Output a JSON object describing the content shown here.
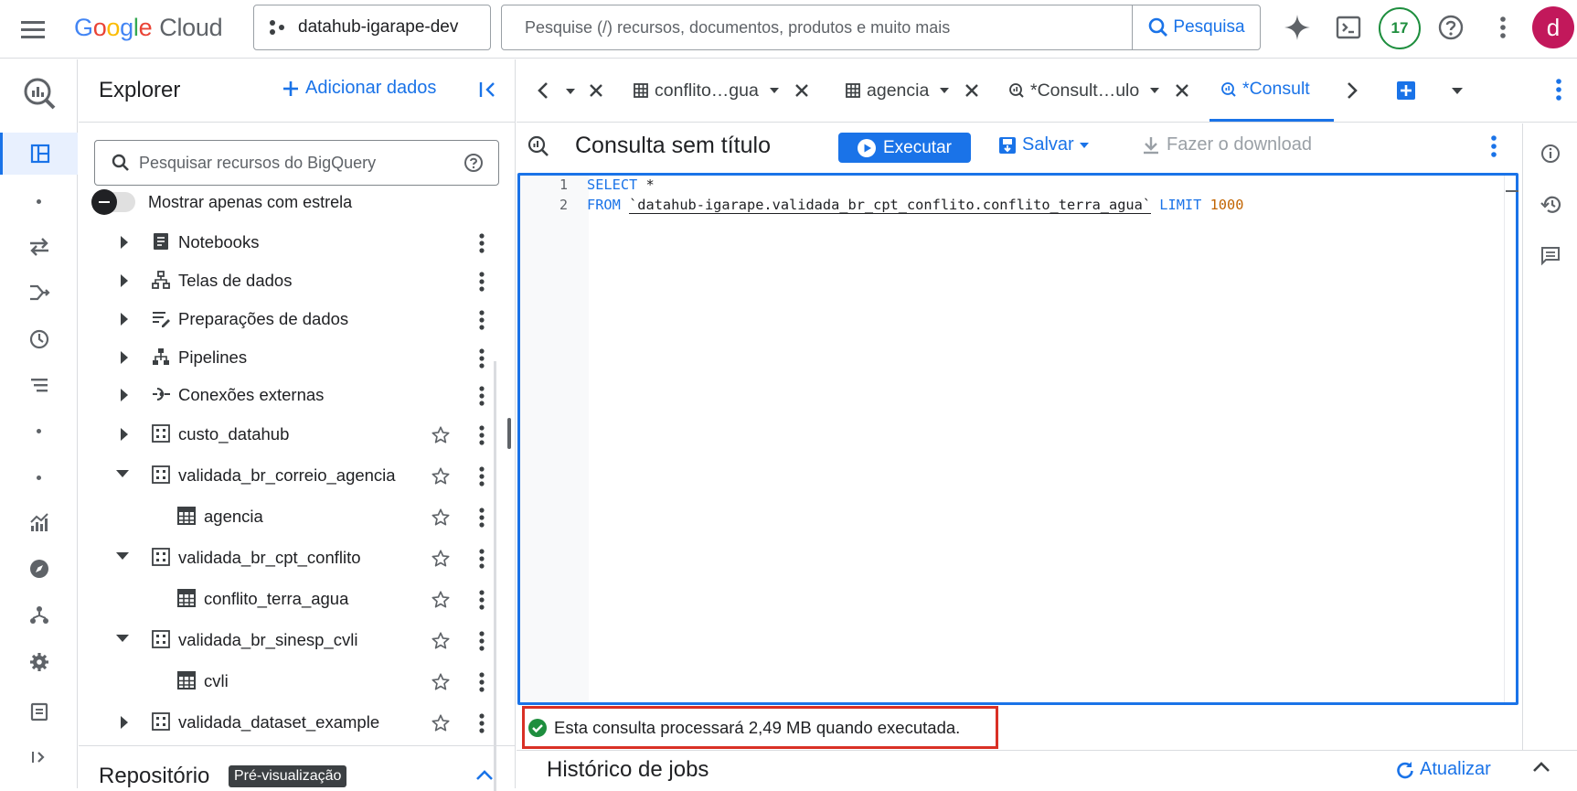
{
  "header": {
    "logo_google": [
      "G",
      "o",
      "o",
      "g",
      "l",
      "e"
    ],
    "logo_cloud": "Cloud",
    "project": "datahub-igarape-dev",
    "search_placeholder": "Pesquise (/) recursos, documentos, produtos e muito mais",
    "search_button": "Pesquisa",
    "notifications_count": "17",
    "avatar_letter": "d"
  },
  "explorer": {
    "title": "Explorer",
    "add_data": "Adicionar dados",
    "search_placeholder": "Pesquisar recursos do BigQuery",
    "star_toggle_label": "Mostrar apenas com estrela",
    "items": [
      {
        "label": "Notebooks",
        "icon": "notebook-icon",
        "expanded": false
      },
      {
        "label": "Telas de dados",
        "icon": "canvas-icon",
        "expanded": false
      },
      {
        "label": "Preparações de dados",
        "icon": "data-prep-icon",
        "expanded": false
      },
      {
        "label": "Pipelines",
        "icon": "pipeline-icon",
        "expanded": false
      },
      {
        "label": "Conexões externas",
        "icon": "connection-icon",
        "expanded": false
      },
      {
        "label": "custo_datahub",
        "icon": "dataset-icon",
        "expanded": false
      },
      {
        "label": "validada_br_correio_agencia",
        "icon": "dataset-icon",
        "expanded": true
      },
      {
        "label": "agencia",
        "icon": "table-icon"
      },
      {
        "label": "validada_br_cpt_conflito",
        "icon": "dataset-icon",
        "expanded": true
      },
      {
        "label": "conflito_terra_agua",
        "icon": "table-icon"
      },
      {
        "label": "validada_br_sinesp_cvli",
        "icon": "dataset-icon",
        "expanded": true
      },
      {
        "label": "cvli",
        "icon": "table-icon"
      },
      {
        "label": "validada_dataset_example",
        "icon": "dataset-icon",
        "expanded": false
      }
    ],
    "repository_title": "Repositório",
    "repository_badge": "Pré-visualização"
  },
  "tabs": [
    {
      "label": "conflito…gua",
      "icon": "table-icon"
    },
    {
      "label": "agencia",
      "icon": "table-icon"
    },
    {
      "label": "*Consult…ulo",
      "icon": "query-icon"
    },
    {
      "label": "*Consult",
      "icon": "query-icon",
      "active": true
    }
  ],
  "query": {
    "title": "Consulta sem título",
    "run_button": "Executar",
    "save_button": "Salvar",
    "download_button": "Fazer o download",
    "lines": [
      {
        "num": "1",
        "kw1": "SELECT",
        "rest": " *"
      },
      {
        "num": "2",
        "kw1": "FROM",
        "table": "`datahub-igarape.validada_br_cpt_conflito.conflito_terra_agua`",
        "kw2": "LIMIT",
        "limit": "1000"
      }
    ],
    "validator_message": "Esta consulta processará 2,49 MB quando executada."
  },
  "jobs": {
    "title": "Histórico de jobs",
    "refresh_button": "Atualizar"
  },
  "colors": {
    "accent": "#1a73e8",
    "success": "#1e8e3e",
    "highlight_box": "#d93025",
    "avatar": "#c2185b"
  }
}
